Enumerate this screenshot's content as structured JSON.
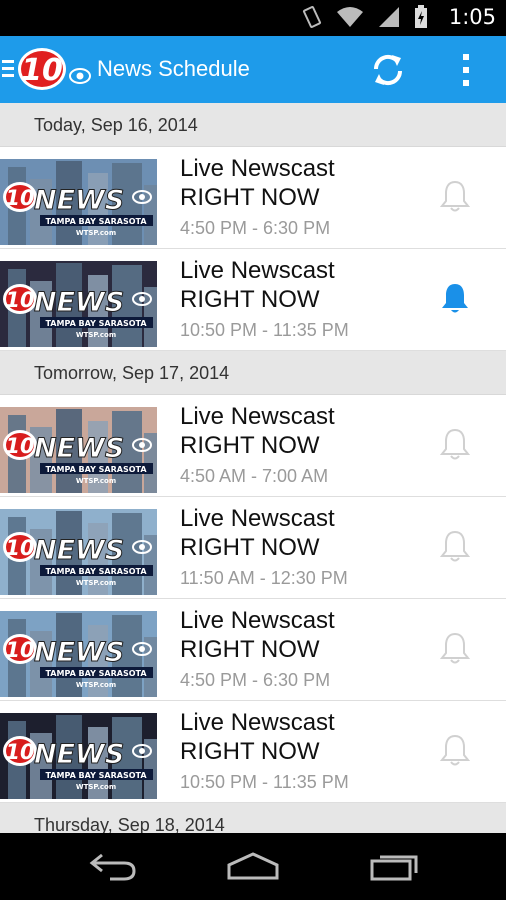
{
  "status": {
    "time": "1:05"
  },
  "app": {
    "title": "News Schedule",
    "logo_text": "10"
  },
  "thumb": {
    "brand": "NEWS",
    "num": "10",
    "sub": "TAMPA BAY  SARASOTA",
    "site": "WTSP.com"
  },
  "sections": [
    {
      "label": "Today, Sep 16, 2014"
    },
    {
      "label": "Tomorrow, Sep 17, 2014"
    },
    {
      "label": "Thursday, Sep 18, 2014"
    }
  ],
  "items": [
    {
      "line1": "Live Newscast",
      "line2": "RIGHT NOW",
      "time": "4:50 PM - 6:30 PM",
      "reminder_on": false
    },
    {
      "line1": "Live Newscast",
      "line2": "RIGHT NOW",
      "time": "10:50 PM - 11:35 PM",
      "reminder_on": true
    },
    {
      "line1": "Live Newscast",
      "line2": "RIGHT NOW",
      "time": "4:50 AM - 7:00 AM",
      "reminder_on": false
    },
    {
      "line1": "Live Newscast",
      "line2": "RIGHT NOW",
      "time": "11:50 AM - 12:30 PM",
      "reminder_on": false
    },
    {
      "line1": "Live Newscast",
      "line2": "RIGHT NOW",
      "time": "4:50 PM - 6:30 PM",
      "reminder_on": false
    },
    {
      "line1": "Live Newscast",
      "line2": "RIGHT NOW",
      "time": "10:50 PM - 11:35 PM",
      "reminder_on": false
    }
  ],
  "colors": {
    "accent": "#1e9bea",
    "bell_on": "#1a90e8",
    "bell_off": "#d0d0d0"
  },
  "icons": {
    "drawer": "drawer-icon",
    "refresh": "refresh-icon",
    "overflow": "overflow-menu-icon",
    "bell": "bell-icon",
    "back": "back-icon",
    "home": "home-icon",
    "recents": "recents-icon"
  }
}
